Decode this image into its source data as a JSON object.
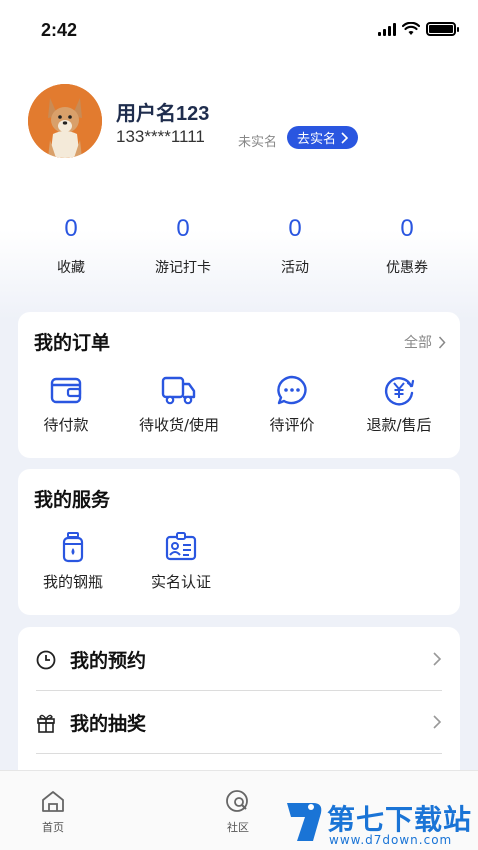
{
  "status_bar": {
    "time": "2:42"
  },
  "profile": {
    "username": "用户名123",
    "phone": "133****1111",
    "unverified": "未实名",
    "verify_button": "去实名"
  },
  "stats": [
    {
      "value": "0",
      "label": "收藏"
    },
    {
      "value": "0",
      "label": "游记打卡"
    },
    {
      "value": "0",
      "label": "活动"
    },
    {
      "value": "0",
      "label": "优惠券"
    }
  ],
  "orders": {
    "title": "我的订单",
    "more": "全部",
    "items": [
      {
        "label": "待付款",
        "icon": "wallet-icon"
      },
      {
        "label": "待收货/使用",
        "icon": "truck-icon"
      },
      {
        "label": "待评价",
        "icon": "comment-icon"
      },
      {
        "label": "退款/售后",
        "icon": "refund-icon"
      }
    ]
  },
  "services": {
    "title": "我的服务",
    "items": [
      {
        "label": "我的钢瓶",
        "icon": "gas-cylinder-icon"
      },
      {
        "label": "实名认证",
        "icon": "id-card-icon"
      }
    ]
  },
  "menu": [
    {
      "label": "我的预约",
      "icon": "clock-icon"
    },
    {
      "label": "我的抽奖",
      "icon": "gift-icon"
    }
  ],
  "tabbar": [
    {
      "label": "首页",
      "icon": "home-icon"
    },
    {
      "label": "社区",
      "icon": "community-icon"
    }
  ],
  "watermark": {
    "text": "第七下载站",
    "url": "www.d7down.com"
  },
  "colors": {
    "accent": "#2a56e0",
    "background": "#eef1f8",
    "watermark": "#1a74d6"
  }
}
